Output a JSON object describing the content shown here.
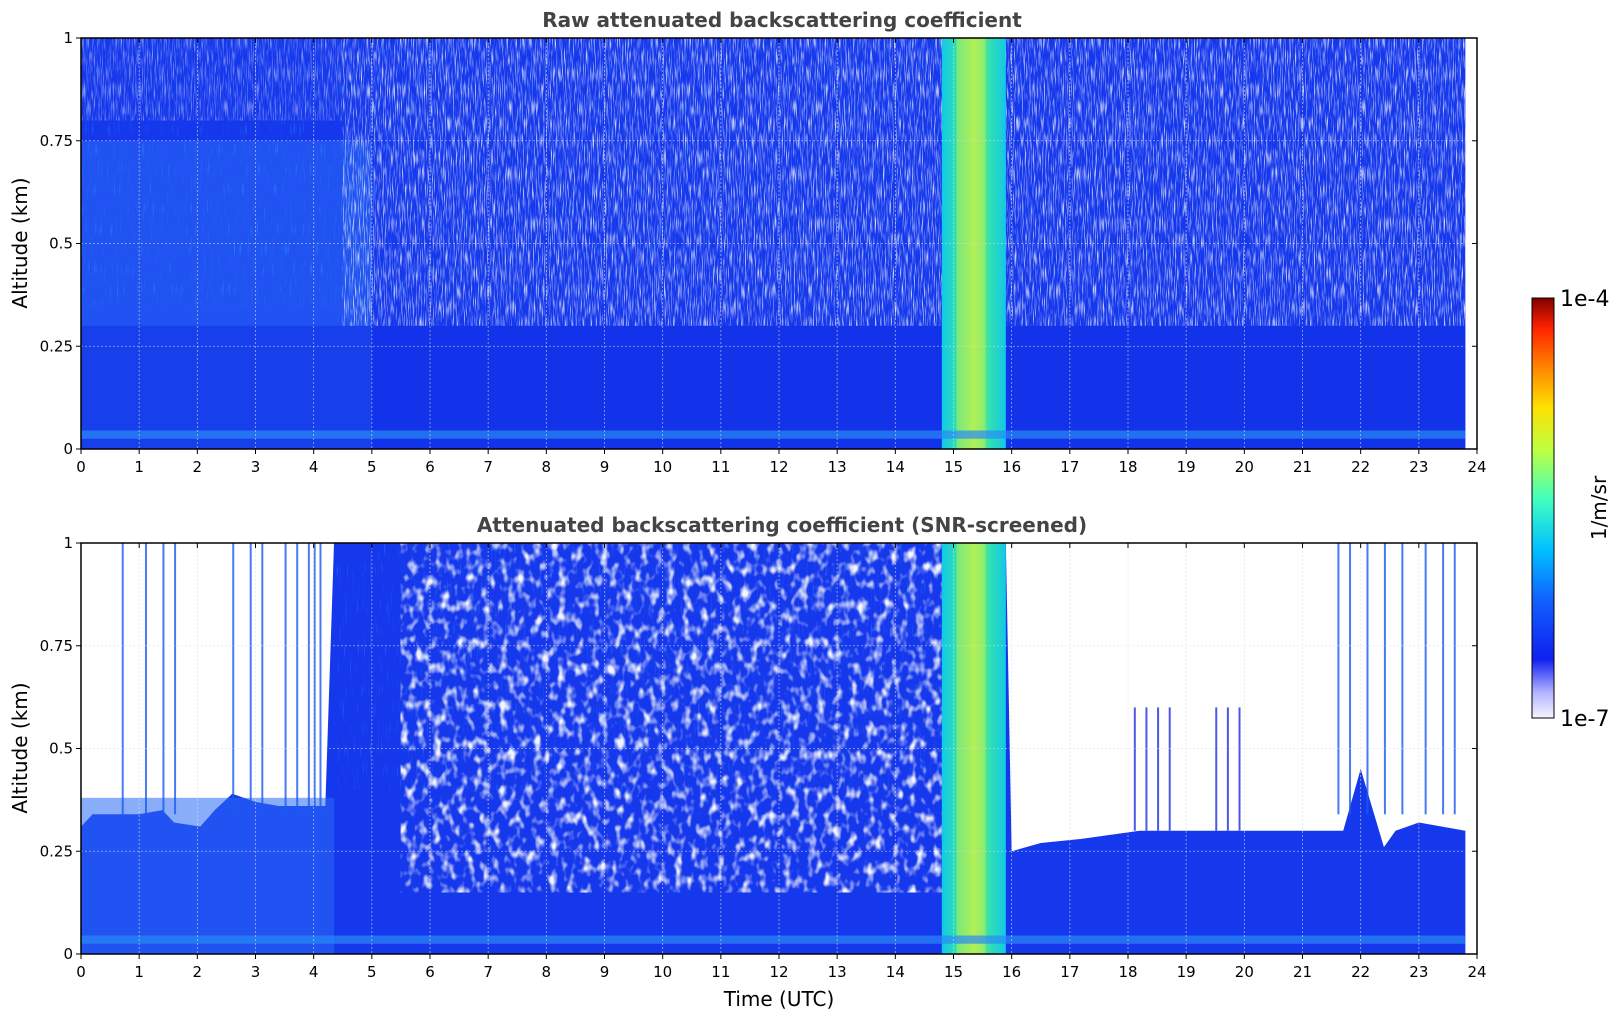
{
  "chart_data": [
    {
      "type": "heatmap",
      "title": "Raw attenuated backscattering coefficient",
      "xlabel": "",
      "ylabel": "Altitude (km)",
      "xlim": [
        0,
        24
      ],
      "ylim": [
        0,
        1
      ],
      "x_ticks": [
        "0",
        "1",
        "2",
        "3",
        "4",
        "5",
        "6",
        "7",
        "8",
        "9",
        "10",
        "11",
        "12",
        "13",
        "14",
        "15",
        "16",
        "17",
        "18",
        "19",
        "20",
        "21",
        "22",
        "23",
        "24"
      ],
      "y_ticks": [
        "0",
        "0.25",
        "0.5",
        "0.75",
        "1"
      ],
      "grid": true,
      "features": [
        {
          "x_range": [
            14.8,
            15.9
          ],
          "altitude_range": [
            0,
            1
          ],
          "level": "high"
        },
        {
          "x_range": [
            0,
            5
          ],
          "altitude_range": [
            0,
            0.75
          ],
          "level": "moderate"
        },
        {
          "x_range": [
            5,
            14.8
          ],
          "altitude_range": [
            0.35,
            1
          ],
          "level": "noisy-low"
        },
        {
          "x_range": [
            16,
            23.8
          ],
          "altitude_range": [
            0.5,
            1
          ],
          "level": "noisy-low"
        },
        {
          "x_range": [
            0,
            23.8
          ],
          "altitude_range": [
            0,
            0.35
          ],
          "level": "moderate"
        }
      ]
    },
    {
      "type": "heatmap",
      "title": "Attenuated backscattering coefficient (SNR-screened)",
      "xlabel": "Time (UTC)",
      "ylabel": "Altitude (km)",
      "xlim": [
        0,
        24
      ],
      "ylim": [
        0,
        1
      ],
      "x_ticks": [
        "0",
        "1",
        "2",
        "3",
        "4",
        "5",
        "6",
        "7",
        "8",
        "9",
        "10",
        "11",
        "12",
        "13",
        "14",
        "15",
        "16",
        "17",
        "18",
        "19",
        "20",
        "21",
        "22",
        "23",
        "24"
      ],
      "y_ticks": [
        "0",
        "0.25",
        "0.5",
        "0.75",
        "1"
      ],
      "grid": true,
      "screen_top_km": [
        [
          0,
          0.31
        ],
        [
          0.2,
          0.34
        ],
        [
          1,
          0.34
        ],
        [
          1.4,
          0.35
        ],
        [
          1.6,
          0.32
        ],
        [
          2.05,
          0.31
        ],
        [
          2.3,
          0.35
        ],
        [
          2.6,
          0.39
        ],
        [
          3,
          0.37
        ],
        [
          3.4,
          0.36
        ],
        [
          4.2,
          0.36
        ],
        [
          4.35,
          1
        ],
        [
          15.9,
          1
        ],
        [
          16.0,
          0.25
        ],
        [
          16.5,
          0.27
        ],
        [
          17.2,
          0.28
        ],
        [
          18.2,
          0.3
        ],
        [
          20,
          0.3
        ],
        [
          21.5,
          0.3
        ],
        [
          21.7,
          0.3
        ],
        [
          22.0,
          0.45
        ],
        [
          22.4,
          0.26
        ],
        [
          22.6,
          0.3
        ],
        [
          23.0,
          0.32
        ],
        [
          23.8,
          0.3
        ]
      ]
    }
  ],
  "colorbar": {
    "label": "1/m/sr",
    "max_label": "1e-4",
    "min_label": "1e-7",
    "colormap": [
      "#f4f4ff",
      "#b4b4ff",
      "#1020f0",
      "#1060ff",
      "#00c0ff",
      "#40ffc0",
      "#c0ff40",
      "#ffe000",
      "#ff8000",
      "#ff2000",
      "#800000"
    ]
  }
}
